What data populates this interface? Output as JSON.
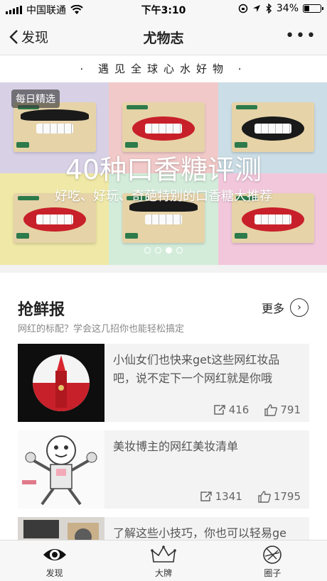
{
  "status_bar": {
    "carrier": "中国联通",
    "time": "下午3:10",
    "battery": "34%",
    "battery_level": 0.34
  },
  "nav": {
    "back_label": "发现",
    "title": "尤物志"
  },
  "tagline": "遇见全球心水好物",
  "banner": {
    "badge": "每日精选",
    "title": "40种口香糖评测",
    "subtitle": "好吃、好玩、奇葩特别的口香糖大推荐",
    "dot_count": 4,
    "active_dot": 2,
    "colors": [
      "#d8d1e6",
      "#f1c9c9",
      "#cbdde6",
      "#efe8a6",
      "#d3ecda",
      "#f2c7dc"
    ]
  },
  "section": {
    "title": "抢鲜报",
    "subtitle": "网红的标配？学会这几招你也能轻松搞定",
    "more_label": "更多",
    "cards": [
      {
        "text": "小仙女们也快来get这些网红妆品吧，说不定下一个网红就是你哦",
        "shares": "416",
        "likes": "791"
      },
      {
        "text": "美妆博主的网红美妆清单",
        "shares": "1341",
        "likes": "1795"
      },
      {
        "text": "了解这些小技巧，你也可以轻易ge"
      }
    ]
  },
  "tabs": [
    {
      "label": "发现",
      "icon": "eye-icon"
    },
    {
      "label": "大牌",
      "icon": "crown-icon"
    },
    {
      "label": "圈子",
      "icon": "aperture-icon"
    }
  ]
}
